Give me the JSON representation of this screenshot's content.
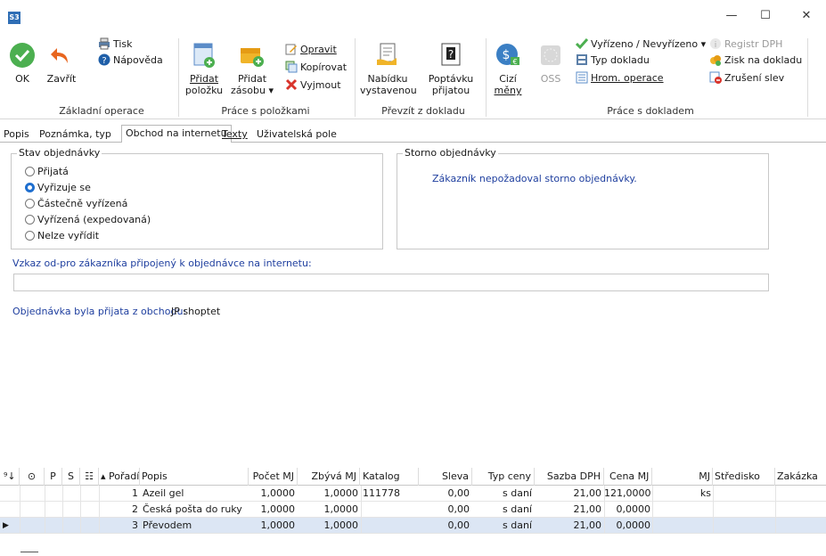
{
  "window": {
    "app_icon": "S3",
    "min": "—",
    "max": "☐",
    "close": "✕"
  },
  "ribbon": {
    "ok": "OK",
    "back": "Zavřít",
    "print": "Tisk",
    "help": "Nápověda",
    "group_basic": "Základní operace",
    "add_item_1": "Přidat",
    "add_item_2": "položku",
    "add_stock_1": "Přidat",
    "add_stock_2": "zásobu ▾",
    "edit": "Opravit",
    "copy": "Kopírovat",
    "cut": "Vyjmout",
    "group_items": "Práce s položkami",
    "offer_1": "Nabídku",
    "offer_2": "vystavenou",
    "demand_1": "Poptávku",
    "demand_2": "přijatou",
    "group_take": "Převzít z dokladu",
    "foreign_1": "Cizí",
    "foreign_2": "měny",
    "oss": "OSS",
    "done": "Vyřízeno / Nevyřízeno ▾",
    "doc_type": "Typ dokladu",
    "bulk": "Hrom. operace",
    "vat_reg": "Registr DPH",
    "profit": "Zisk na dokladu",
    "cancel_disc": "Zrušení slev",
    "group_doc": "Práce s dokladem"
  },
  "tabs": [
    "Popis",
    "Poznámka, typ",
    "Obchod na internetu",
    "Texty",
    "Uživatelská pole"
  ],
  "state": {
    "legend": "Stav objednávky",
    "options": [
      "Přijatá",
      "Vyřizuje se",
      "Částečně vyřízená",
      "Vyřízená (expedovaná)",
      "Nelze vyřídit"
    ],
    "selected": "Vyřizuje se"
  },
  "storno": {
    "legend": "Storno objednávky",
    "text": "Zákazník nepožadoval storno objednávky."
  },
  "message": {
    "label": "Vzkaz od-pro zákazníka připojený k objednávce na internetu:",
    "value": ""
  },
  "shop": {
    "label": "Objednávka byla přijata z obchodu:",
    "value": "JP shoptet"
  },
  "grid": {
    "headers": [
      "⁹↓",
      "⊙",
      "P",
      "S",
      "☷",
      "▴ Pořadí",
      "Popis",
      "Počet MJ",
      "Zbývá MJ",
      "Katalog",
      "Sleva",
      "Typ ceny",
      "Sazba DPH",
      "Cena MJ",
      "MJ",
      "Středisko",
      "Zakázka"
    ],
    "rows": [
      {
        "order": "1",
        "desc": "Azeil gel",
        "qty": "1,0000",
        "left": "1,0000",
        "catalog": "111778",
        "disc": "0,00",
        "ptype": "s daní",
        "vat": "21,00",
        "price": "121,0000",
        "unit": "ks"
      },
      {
        "order": "2",
        "desc": "Česká pošta do ruky",
        "qty": "1,0000",
        "left": "1,0000",
        "catalog": "",
        "disc": "0,00",
        "ptype": "s daní",
        "vat": "21,00",
        "price": "0,0000",
        "unit": ""
      },
      {
        "order": "3",
        "desc": "Převodem",
        "qty": "1,0000",
        "left": "1,0000",
        "catalog": "",
        "disc": "0,00",
        "ptype": "s daní",
        "vat": "21,00",
        "price": "0,0000",
        "unit": ""
      }
    ]
  }
}
